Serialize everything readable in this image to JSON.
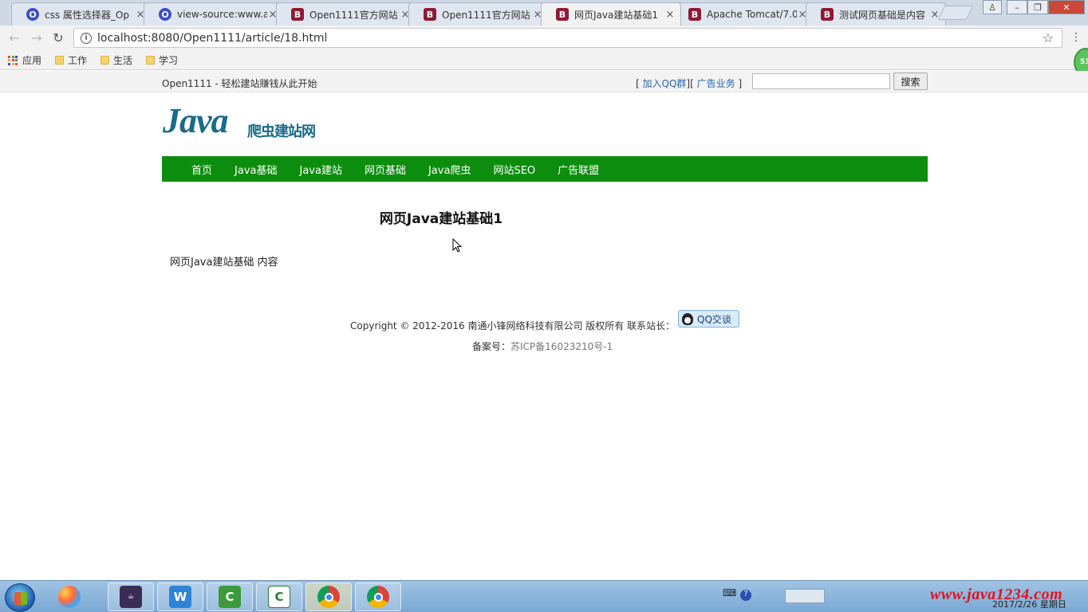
{
  "browser": {
    "tabs": [
      {
        "icon": "O",
        "icon_type": "o",
        "title": "css 属性选择器_Op"
      },
      {
        "icon": "O",
        "icon_type": "o",
        "title": "view-source:www.a"
      },
      {
        "icon": "B",
        "icon_type": "b",
        "title": "Open1111官方网站"
      },
      {
        "icon": "B",
        "icon_type": "b",
        "title": "Open1111官方网站"
      },
      {
        "icon": "B",
        "icon_type": "b",
        "title": "网页Java建站基础1"
      },
      {
        "icon": "B",
        "icon_type": "b",
        "title": "Apache Tomcat/7.0"
      },
      {
        "icon": "B",
        "icon_type": "b",
        "title": "测试网页基础是内容"
      }
    ],
    "active_tab_index": 4,
    "close_glyph": "×",
    "url": "localhost:8080/Open1111/article/18.html",
    "bookmarks": {
      "apps": "应用",
      "folders": [
        "工作",
        "生活",
        "学习"
      ]
    },
    "extension_badge": "53"
  },
  "page": {
    "slogan": "Open1111 - 轻松建站赚钱从此开始",
    "toplinks": {
      "open_bracket": "[",
      "qq_group": "加入QQ群",
      "separator": "][",
      "ads": "广告业务",
      "close_bracket": "]"
    },
    "search_button": "搜索",
    "logo": {
      "java": "Java",
      "subtitle": "爬虫建站网"
    },
    "nav": [
      "首页",
      "Java基础",
      "Java建站",
      "网页基础",
      "Java爬虫",
      "网站SEO",
      "广告联盟"
    ],
    "nav_color": "#0d8d0d",
    "article": {
      "title": "网页Java建站基础1",
      "body": "网页Java建站基础 内容"
    },
    "footer": {
      "copyright": "Copyright © 2012-2016 南通小锋网络科技有限公司 版权所有 联系站长：",
      "qq_button": "QQ交谈",
      "icp_label": "备案号：",
      "icp_number": "苏ICP备16023210号-1"
    }
  },
  "taskbar": {
    "apps": [
      "java-ee-ide",
      "wps-writer",
      "camtasia-recorder",
      "camtasia-studio",
      "chrome",
      "chrome"
    ],
    "watermark": "www.java1234.com",
    "date": "2017/2/26 星期日"
  }
}
